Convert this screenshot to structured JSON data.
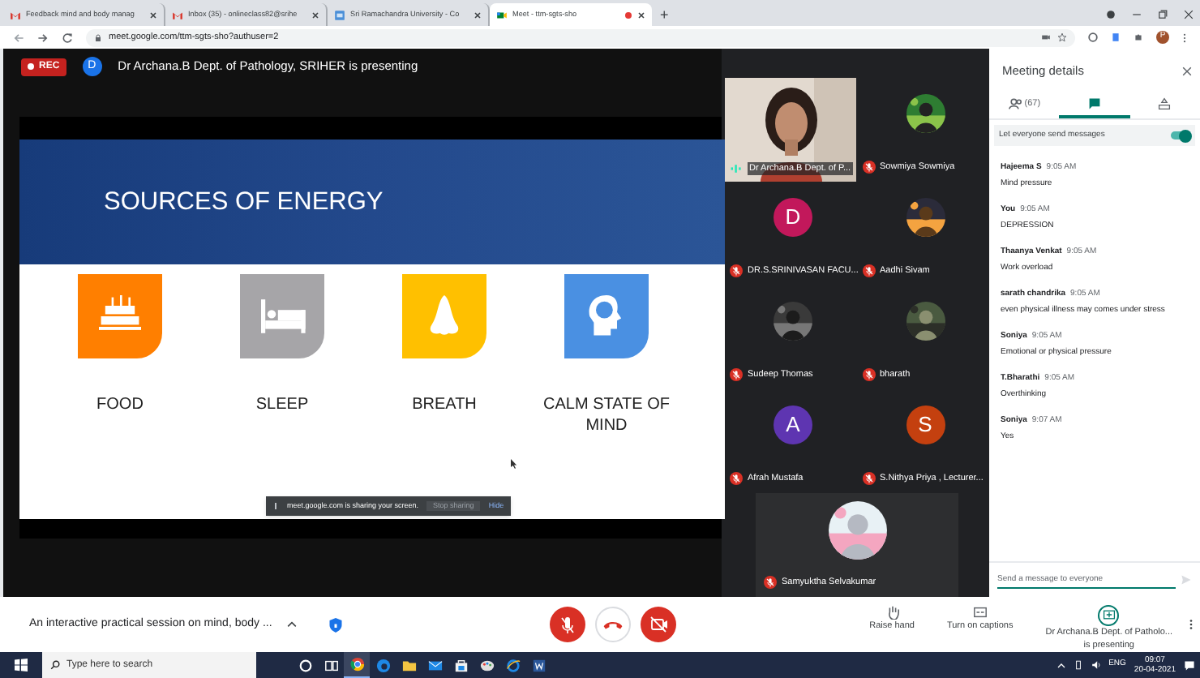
{
  "browser": {
    "tabs": [
      {
        "title": "Feedback mind and body manag",
        "kind": "gmail",
        "selected": false,
        "recording": false
      },
      {
        "title": "Inbox (35) - onlineclass82@srihe",
        "kind": "gmail",
        "selected": false,
        "recording": false
      },
      {
        "title": "Sri Ramachandra University - Co",
        "kind": "site",
        "selected": false,
        "recording": false
      },
      {
        "title": "Meet - ttm-sgts-sho",
        "kind": "meet",
        "selected": true,
        "recording": true
      }
    ],
    "new_tab": "+",
    "address": "meet.google.com/ttm-sgts-sho?authuser=2",
    "profile_initial": "P"
  },
  "stage": {
    "rec_label": "REC",
    "presenter_initial": "D",
    "presenter_banner": "Dr Archana.B Dept. of Pathology, SRIHER is presenting",
    "slide": {
      "title": "SOURCES OF ENERGY",
      "items": [
        {
          "label": "FOOD",
          "kind": "cake",
          "color": "#ff7f00"
        },
        {
          "label": "SLEEP",
          "kind": "bed",
          "color": "#a6a5a8"
        },
        {
          "label": "BREATH",
          "kind": "nose",
          "color": "#ffc000"
        },
        {
          "label": "CALM STATE OF MIND",
          "kind": "head",
          "color": "#4a90e2"
        }
      ]
    },
    "share_notice": {
      "text": "meet.google.com is sharing your screen.",
      "stop": "Stop sharing",
      "hide": "Hide"
    }
  },
  "participants": [
    {
      "name": "Dr Archana.B Dept. of P...",
      "kind": "video",
      "muted": false
    },
    {
      "name": "Sowmiya Sowmiya",
      "muted": true
    },
    {
      "name": "DR.S.SRINIVASAN FACU...",
      "kind": "letter",
      "initial": "D",
      "color": "#c2185b",
      "muted": true
    },
    {
      "name": "Aadhi Sivam",
      "muted": true
    },
    {
      "name": "Sudeep Thomas",
      "muted": true
    },
    {
      "name": "bharath",
      "muted": true
    },
    {
      "name": "Afrah Mustafa",
      "kind": "letter",
      "initial": "A",
      "color": "#5e35b1",
      "muted": true
    },
    {
      "name": "S.Nithya Priya , Lecturer...",
      "kind": "letter",
      "initial": "S",
      "color": "#c4400f",
      "muted": true
    },
    {
      "name": "Samyuktha Selvakumar",
      "muted": true
    }
  ],
  "panel": {
    "title": "Meeting details",
    "tabs": [
      {
        "kind": "people",
        "label": "(67)",
        "selected": false
      },
      {
        "kind": "chat",
        "selected": true
      },
      {
        "kind": "activities",
        "selected": false
      }
    ],
    "toggle": {
      "label": "Let everyone send messages",
      "on": true
    },
    "messages": [
      {
        "sender": "Hajeema S",
        "time": "9:05 AM",
        "text": "Mind pressure"
      },
      {
        "sender": "You",
        "time": "9:05 AM",
        "text": "DEPRESSION"
      },
      {
        "sender": "Thaanya Venkat",
        "time": "9:05 AM",
        "text": "Work overload"
      },
      {
        "sender": "sarath chandrika",
        "time": "9:05 AM",
        "text": "even physical illness may comes under stress"
      },
      {
        "sender": "Soniya",
        "time": "9:05 AM",
        "text": "Emotional or physical pressure"
      },
      {
        "sender": "T.Bharathi",
        "time": "9:05 AM",
        "text": "Overthinking"
      },
      {
        "sender": "Soniya",
        "time": "9:07 AM",
        "text": "Yes"
      }
    ],
    "input": {
      "placeholder": "Send a message to everyone"
    }
  },
  "bottom_bar": {
    "meeting_title": "An interactive practical session on mind, body ...",
    "controls": [
      {
        "kind": "mic",
        "off": true
      },
      {
        "kind": "hangup"
      },
      {
        "kind": "camera",
        "off": true
      }
    ],
    "actions": [
      {
        "kind": "hand",
        "label": "Raise hand"
      },
      {
        "kind": "captions",
        "label": "Turn on captions"
      },
      {
        "kind": "present",
        "label": "Dr Archana.B Dept. of Patholo...",
        "sublabel": "is presenting"
      }
    ]
  },
  "taskbar": {
    "search": "Type here to search",
    "apps": [
      {
        "kind": "cortana",
        "selected": false
      },
      {
        "kind": "taskview",
        "selected": false
      },
      {
        "kind": "chrome",
        "selected": true
      },
      {
        "kind": "edge",
        "selected": false
      },
      {
        "kind": "folder",
        "selected": false
      },
      {
        "kind": "mail",
        "selected": false
      },
      {
        "kind": "store",
        "selected": false
      },
      {
        "kind": "paint",
        "selected": false
      },
      {
        "kind": "ie",
        "selected": false
      },
      {
        "kind": "word",
        "selected": false
      }
    ],
    "language": "ENG",
    "time": "09:07",
    "date": "20-04-2021"
  }
}
